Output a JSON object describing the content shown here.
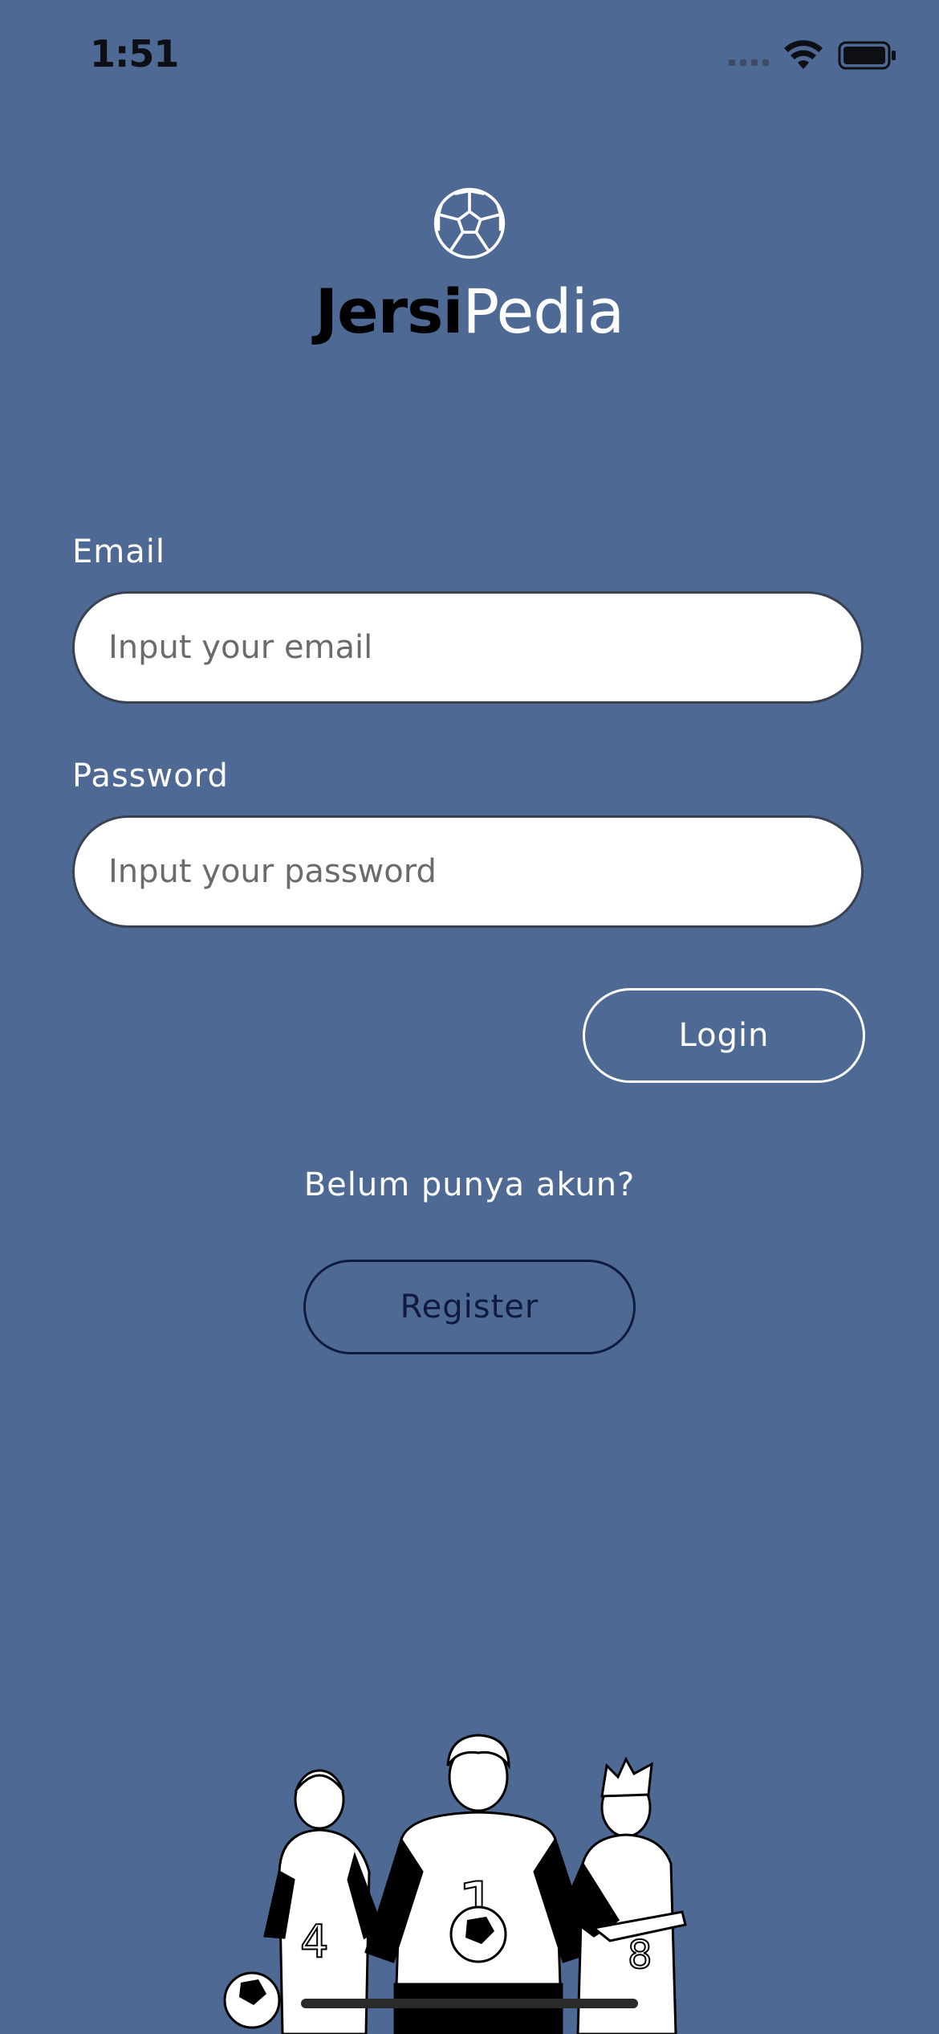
{
  "status_bar": {
    "time": "1:51",
    "icons": [
      "cellular-signal-icon",
      "wifi-icon",
      "battery-icon"
    ]
  },
  "logo": {
    "icon": "soccer-ball-icon",
    "brand_part1": "Jersi",
    "brand_part2": "Pedia"
  },
  "form": {
    "email_label": "Email",
    "email_placeholder": "Input your email",
    "email_value": "",
    "password_label": "Password",
    "password_placeholder": "Input your password",
    "password_value": "",
    "login_label": "Login"
  },
  "register_section": {
    "prompt": "Belum punya akun?",
    "register_label": "Register"
  },
  "illustration": {
    "name": "football-players-illustration",
    "jersey_numbers": [
      "4",
      "1",
      "8"
    ]
  },
  "colors": {
    "background": "#4e6a94",
    "brand_dark": "#000000",
    "brand_light": "#ffffff",
    "register_border": "#101a3f"
  }
}
